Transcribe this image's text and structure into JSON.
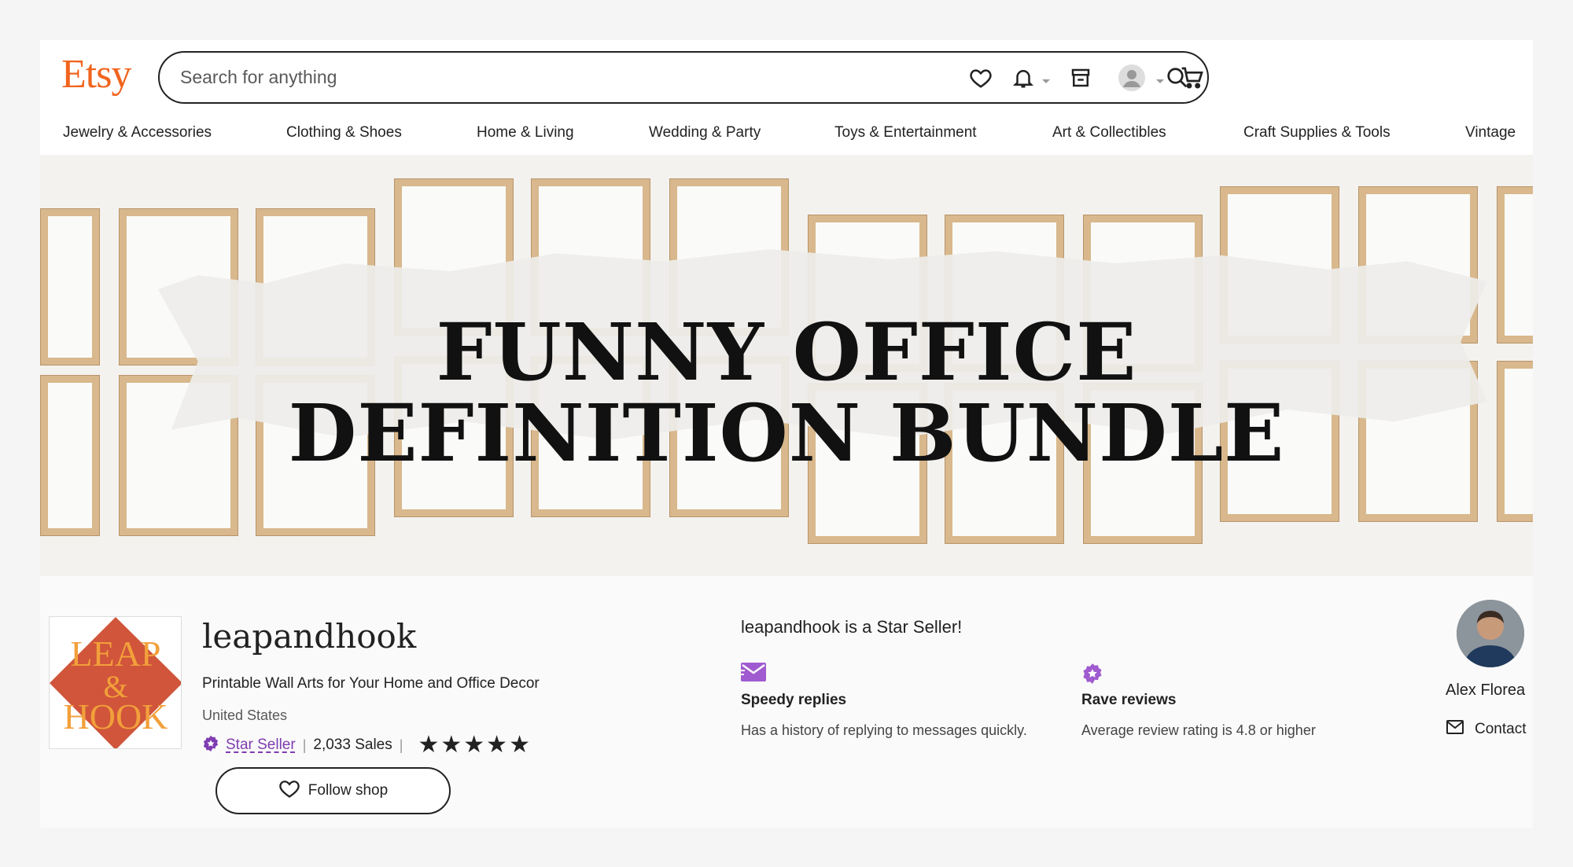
{
  "header": {
    "logo": "Etsy",
    "search_placeholder": "Search for anything",
    "icons": [
      "heart-icon",
      "bell-icon",
      "shop-icon",
      "avatar-icon",
      "cart-icon"
    ]
  },
  "nav": {
    "items": [
      {
        "label": "Jewelry & Accessories"
      },
      {
        "label": "Clothing & Shoes"
      },
      {
        "label": "Home & Living"
      },
      {
        "label": "Wedding & Party"
      },
      {
        "label": "Toys & Entertainment"
      },
      {
        "label": "Art & Collectibles"
      },
      {
        "label": "Craft Supplies & Tools"
      },
      {
        "label": "Vintage"
      }
    ]
  },
  "banner": {
    "line1": "FUNNY OFFICE",
    "line2": "DEFINITION BUNDLE"
  },
  "shop": {
    "logo_text": {
      "line1": "LEAP",
      "line2": "&",
      "line3": "HOOK"
    },
    "name": "leapandhook",
    "tagline": "Printable Wall Arts for Your Home and Office Decor",
    "location": "United States",
    "star_seller_label": "Star Seller",
    "sales": "2,033 Sales",
    "rating_stars": 5,
    "follow_label": "Follow shop"
  },
  "star_seller": {
    "heading": "leapandhook is a Star Seller!",
    "features": [
      {
        "icon": "envelope-icon",
        "title": "Speedy replies",
        "desc": "Has a history of replying to messages quickly."
      },
      {
        "icon": "star-badge-icon",
        "title": "Rave reviews",
        "desc": "Average review rating is 4.8 or higher"
      }
    ]
  },
  "owner": {
    "name": "Alex Florea",
    "contact_label": "Contact"
  },
  "colors": {
    "brand": "#F1641E",
    "star_seller": "#7E3DB0",
    "shop_logo_bg": "#D0553A",
    "shop_logo_text": "#F2A03A"
  }
}
